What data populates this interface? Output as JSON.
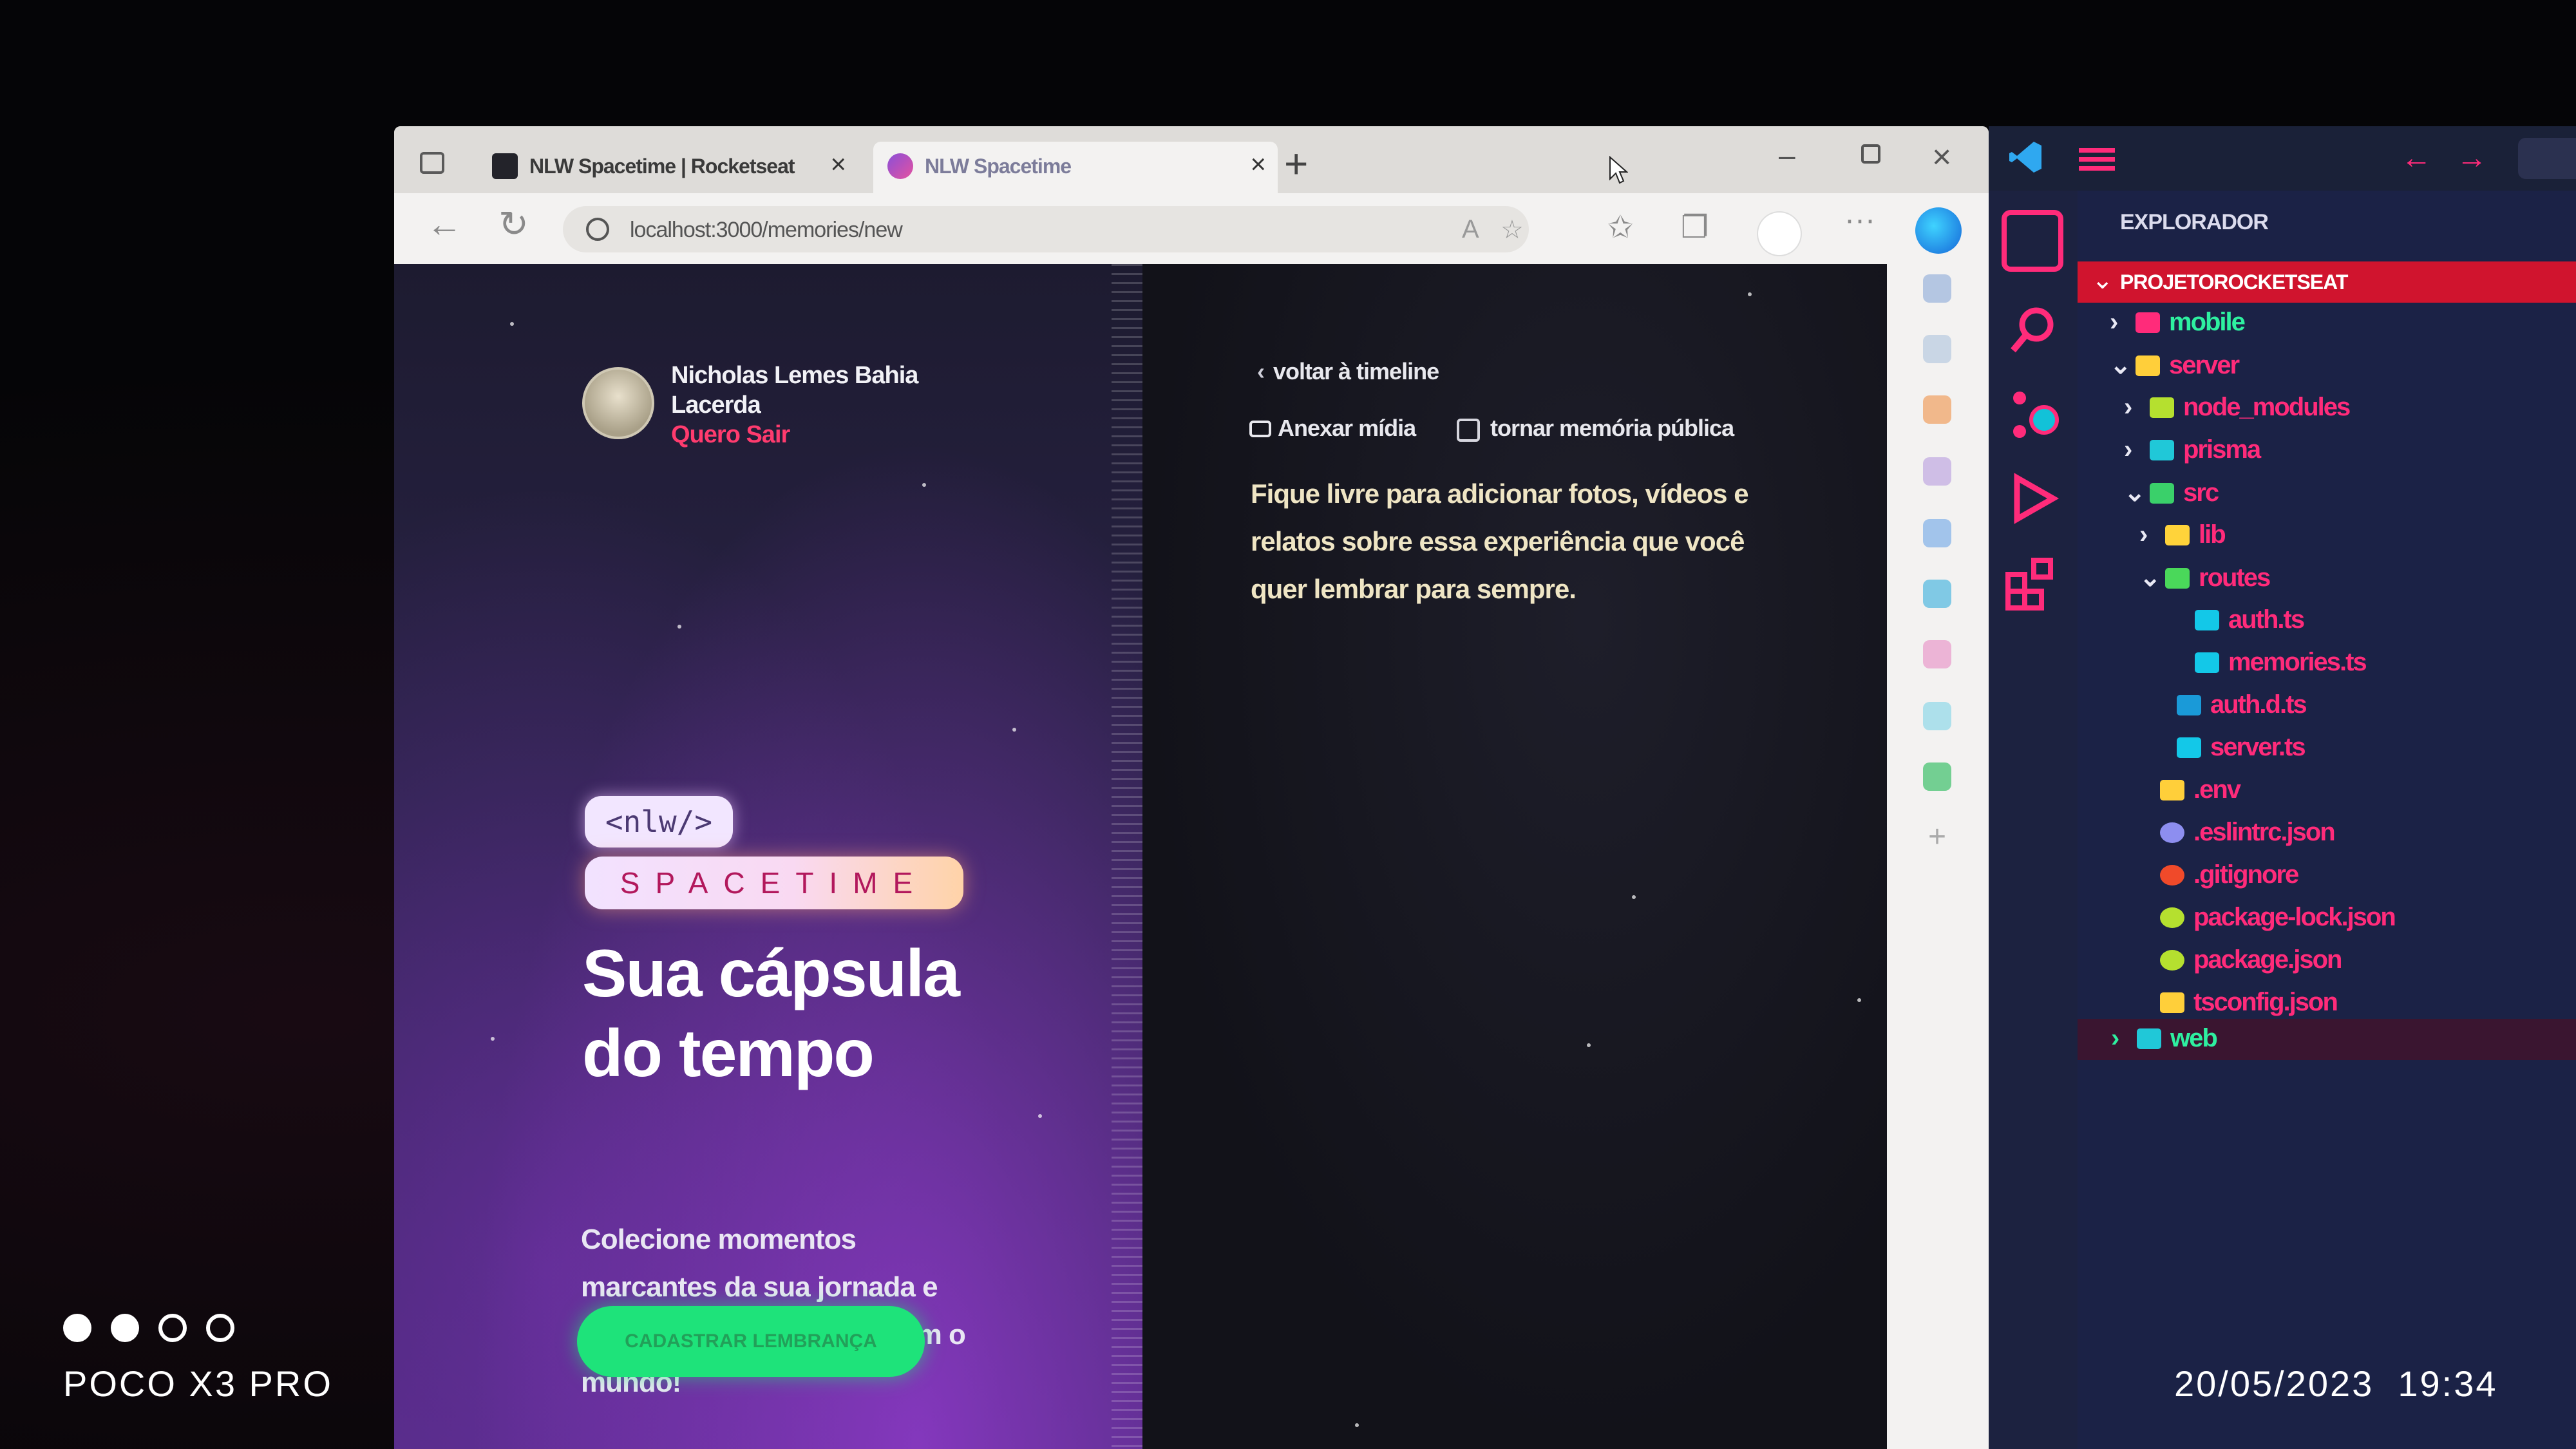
{
  "browser": {
    "tabs": [
      {
        "title": "NLW Spacetime | Rocketseat",
        "active": false
      },
      {
        "title": "NLW Spacetime",
        "active": true
      }
    ],
    "new_tab": "+",
    "url": "localhost:3000/memories/new"
  },
  "app": {
    "user": {
      "name": "Nicholas Lemes Bahia Lacerda",
      "logout": "Quero Sair"
    },
    "logo": {
      "nlw": "<nlw/>",
      "spacetime": "SPACETIME"
    },
    "hero": {
      "title": "Sua cápsula do tempo",
      "subtitle": "Colecione momentos marcantes da sua jornada e compartilhe (se quiser) com o mundo!",
      "cta": "CADASTRAR LEMBRANÇA"
    },
    "form": {
      "back": "voltar à timeline",
      "attach_media": "Anexar mídia",
      "make_public": "tornar memória pública",
      "make_public_checked": false,
      "placeholder": "Fique livre para adicionar fotos, vídeos e relatos sobre essa experiência que você quer lembrar para sempre."
    }
  },
  "vscode": {
    "explorer_title": "EXPLORADOR",
    "project": "PROJETOROCKETSEAT",
    "tree": [
      {
        "label": "mobile",
        "type": "folder",
        "expanded": false,
        "color": "#2ef0a0"
      },
      {
        "label": "server",
        "type": "folder",
        "expanded": true,
        "color": "#ff2b7a"
      },
      {
        "label": "node_modules",
        "type": "folder",
        "expanded": false,
        "color": "#ff2b7a"
      },
      {
        "label": "prisma",
        "type": "folder",
        "expanded": false,
        "color": "#ff2b7a"
      },
      {
        "label": "src",
        "type": "folder",
        "expanded": true,
        "color": "#ff2b7a"
      },
      {
        "label": "lib",
        "type": "folder",
        "expanded": false,
        "color": "#ff2b7a"
      },
      {
        "label": "routes",
        "type": "folder",
        "expanded": true,
        "color": "#ff2b7a"
      },
      {
        "label": "auth.ts",
        "type": "file",
        "color": "#ff2b7a"
      },
      {
        "label": "memories.ts",
        "type": "file",
        "color": "#ff2b7a"
      },
      {
        "label": "auth.d.ts",
        "type": "file",
        "color": "#ff2b7a"
      },
      {
        "label": "server.ts",
        "type": "file",
        "color": "#ff2b7a"
      },
      {
        "label": ".env",
        "type": "file",
        "color": "#ff2b7a"
      },
      {
        "label": ".eslintrc.json",
        "type": "file",
        "color": "#ff2b7a"
      },
      {
        "label": ".gitignore",
        "type": "file",
        "color": "#ff2b7a"
      },
      {
        "label": "package-lock.json",
        "type": "file",
        "color": "#ff2b7a"
      },
      {
        "label": "package.json",
        "type": "file",
        "color": "#ff2b7a"
      },
      {
        "label": "tsconfig.json",
        "type": "file",
        "color": "#ff2b7a"
      },
      {
        "label": "web",
        "type": "folder",
        "expanded": false,
        "color": "#2ef0a0"
      }
    ]
  },
  "photo_overlay": {
    "device": "POCO X3 PRO",
    "timestamp": "20/05/2023  19:34"
  },
  "colors": {
    "accent_pink": "#ff2b7a",
    "accent_green": "#1ee37a",
    "vscode_bg": "#1b2246"
  }
}
